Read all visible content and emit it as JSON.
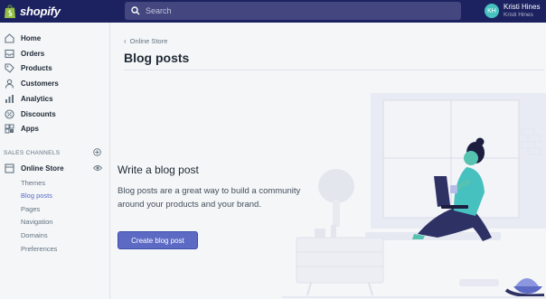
{
  "topbar": {
    "logo_text": "shopify",
    "search_placeholder": "Search",
    "user_initials": "KH",
    "user_name": "Kristi Hines",
    "user_store": "Kristi Hines"
  },
  "sidebar": {
    "items": [
      {
        "label": "Home",
        "icon": "home-icon"
      },
      {
        "label": "Orders",
        "icon": "orders-icon"
      },
      {
        "label": "Products",
        "icon": "tag-icon"
      },
      {
        "label": "Customers",
        "icon": "person-icon"
      },
      {
        "label": "Analytics",
        "icon": "bar-chart-icon"
      },
      {
        "label": "Discounts",
        "icon": "discount-icon"
      },
      {
        "label": "Apps",
        "icon": "apps-icon"
      }
    ],
    "sales_channels_label": "SALES CHANNELS",
    "online_store_label": "Online Store",
    "sub_items": [
      "Themes",
      "Blog posts",
      "Pages",
      "Navigation",
      "Domains",
      "Preferences"
    ],
    "active_sub_item": "Blog posts"
  },
  "main": {
    "breadcrumb": "Online Store",
    "title": "Blog posts",
    "empty_title": "Write a blog post",
    "empty_body": "Blog posts are a great way to build a community around your products and your brand.",
    "cta_label": "Create blog post"
  },
  "colors": {
    "topbar": "#1c2260",
    "accent": "#5c6ac4",
    "avatar": "#47c1bf"
  }
}
